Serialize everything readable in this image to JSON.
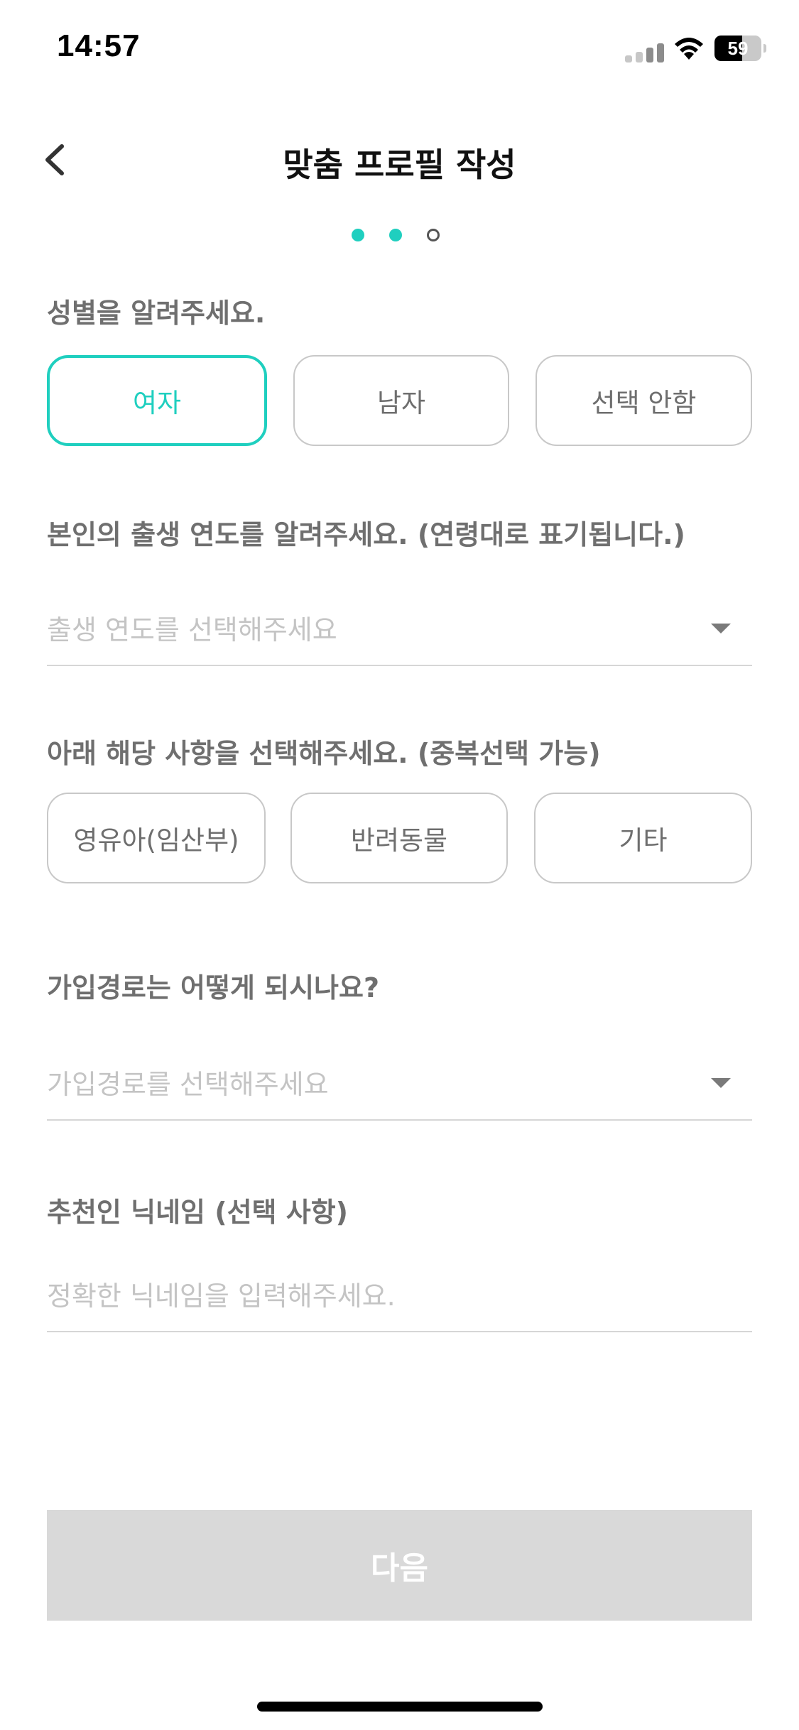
{
  "status_bar": {
    "time": "14:57",
    "battery_level": "59",
    "battery_percent": 59
  },
  "header": {
    "title": "맞춤 프로필 작성",
    "back_icon": "chevron-left-icon"
  },
  "stepper": {
    "total_steps": 3,
    "current_step": 2,
    "active_color": "#1fcfbf"
  },
  "gender": {
    "label": "성별을 알려주세요.",
    "options": [
      "여자",
      "남자",
      "선택 안함"
    ],
    "selected": "여자"
  },
  "birth_year": {
    "label": "본인의 출생 연도를 알려주세요. (연령대로 표기됩니다.)",
    "placeholder": "출생 연도를 선택해주세요",
    "icon": "dropdown-arrow-icon"
  },
  "attributes": {
    "label": "아래 해당 사항을 선택해주세요. (중복선택 가능)",
    "options": [
      "영유아(임산부)",
      "반려동물",
      "기타"
    ]
  },
  "signup_path": {
    "label": "가입경로는 어떻게 되시나요?",
    "placeholder": "가입경로를 선택해주세요",
    "icon": "dropdown-arrow-icon"
  },
  "referrer": {
    "label": "추천인 닉네임 (선택 사항)",
    "placeholder": "정확한 닉네임을 입력해주세요."
  },
  "next_button": {
    "label": "다음",
    "enabled": false
  },
  "colors": {
    "accent": "#1fcfbf",
    "disabled_button": "#d9d9d9",
    "label_gray": "#6f6f6f",
    "placeholder_gray": "#c4c4c4"
  }
}
